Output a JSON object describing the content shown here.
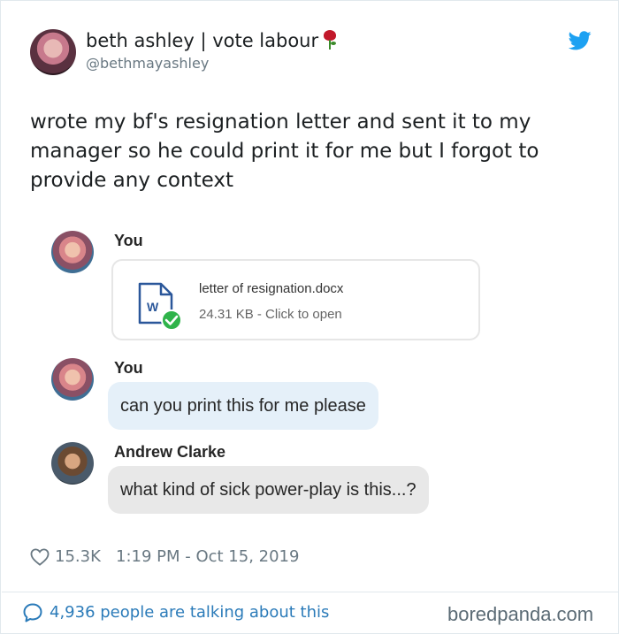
{
  "tweet": {
    "display_name": "beth ashley | vote labour",
    "display_name_emoji": "rose-icon",
    "handle": "@bethmayashley",
    "text": "wrote my bf's resignation letter and sent it to my manager so he could print it for me but I forgot to provide any context",
    "likes": "15.3K",
    "timestamp": "1:19 PM - Oct 15, 2019",
    "replies_text": "4,936 people are talking about this"
  },
  "embedded_chat": {
    "messages": [
      {
        "sender": "You",
        "type": "file",
        "file_name": "letter of resignation.docx",
        "file_meta": "24.31 KB - Click to open"
      },
      {
        "sender": "You",
        "type": "text",
        "text": "can you print this for me please"
      },
      {
        "sender": "Andrew Clarke",
        "type": "text",
        "text": "what kind of sick power-play is this...?"
      }
    ]
  },
  "watermark": "boredpanda.com",
  "colors": {
    "twitter_blue": "#1da1f2",
    "link_blue": "#2b7bb9",
    "secondary_text": "#697882",
    "word_blue": "#2b579a",
    "check_green": "#2fb34a",
    "bubble_blue": "#e5f0f9",
    "bubble_gray": "#e8e8e8"
  }
}
